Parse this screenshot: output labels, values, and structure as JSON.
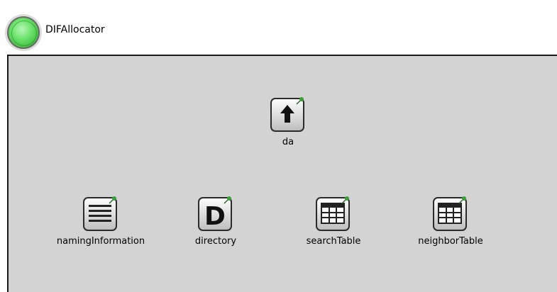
{
  "module": {
    "title": "DIFAllocator",
    "icon": "green-circle-module-icon"
  },
  "submodules": [
    {
      "name": "da",
      "icon": "arrow-up-block-icon"
    },
    {
      "name": "namingInformation",
      "icon": "list-block-icon"
    },
    {
      "name": "directory",
      "icon": "letter-d-block-icon"
    },
    {
      "name": "searchTable",
      "icon": "table-block-icon"
    },
    {
      "name": "neighborTable",
      "icon": "table-block-icon"
    }
  ],
  "colors": {
    "canvas_bg": "#d3d3d3",
    "border": "#1a1a1a",
    "pin": "#3aa03a"
  }
}
